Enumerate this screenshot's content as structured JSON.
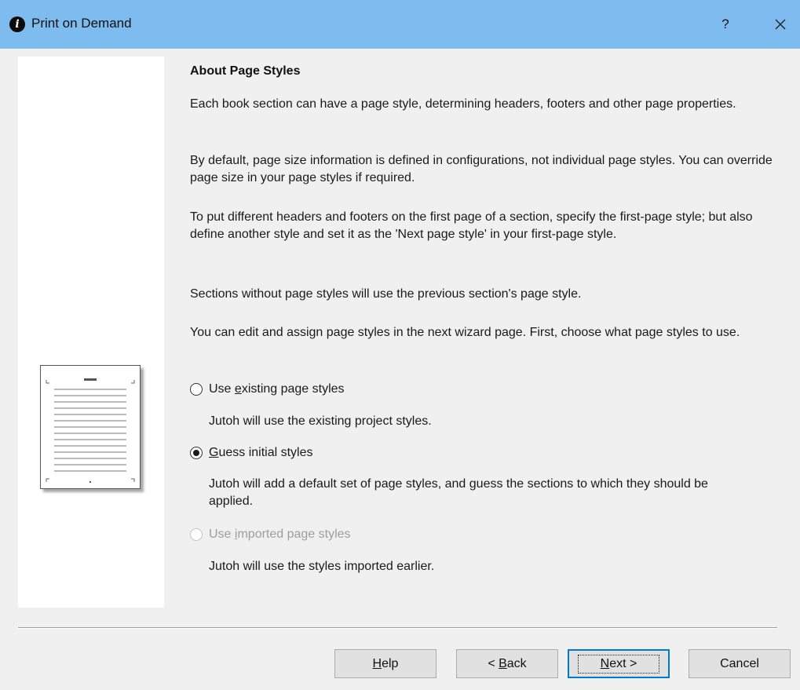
{
  "window": {
    "title": "Print on Demand",
    "help_label": "?",
    "close_label": "×",
    "colors": {
      "titlebar": "#7ebcf0",
      "background": "#f0f0f0",
      "accent": "#0078d7"
    }
  },
  "content": {
    "heading": "About Page Styles",
    "paragraphs": [
      "Each book section can have a page style, determining headers, footers and other page properties.",
      "By default, page size information is defined in configurations, not individual page styles. You can override page size in your page styles if required.",
      "To put different headers and footers on the first page of a section, specify the first-page style; but also define another style and set it as the 'Next page style' in your first-page style.",
      "Sections without page styles will use the previous section's page style.",
      "You can edit and assign page styles in the next wizard page. First, choose what page styles to use."
    ],
    "options": [
      {
        "pre": "Use ",
        "accel": "e",
        "post": "xisting page styles",
        "description": "Jutoh will use the existing project styles.",
        "selected": false,
        "disabled": false
      },
      {
        "pre": "",
        "accel": "G",
        "post": "uess initial styles",
        "description": "Jutoh will add a default set of page styles, and guess the sections to which they should be applied.",
        "selected": true,
        "disabled": false
      },
      {
        "pre": "Use ",
        "accel": "i",
        "post": "mported page styles",
        "description": "Jutoh will use the styles imported earlier.",
        "selected": false,
        "disabled": true
      }
    ]
  },
  "buttons": {
    "help": {
      "accel": "H",
      "post": "elp"
    },
    "back": {
      "pre": "< ",
      "accel": "B",
      "post": "ack"
    },
    "next": {
      "accel": "N",
      "post": "ext >"
    },
    "cancel": {
      "label": "Cancel"
    }
  },
  "icons": {
    "app": "jutoh-info-icon",
    "page_preview": "page-layout-preview-icon"
  }
}
